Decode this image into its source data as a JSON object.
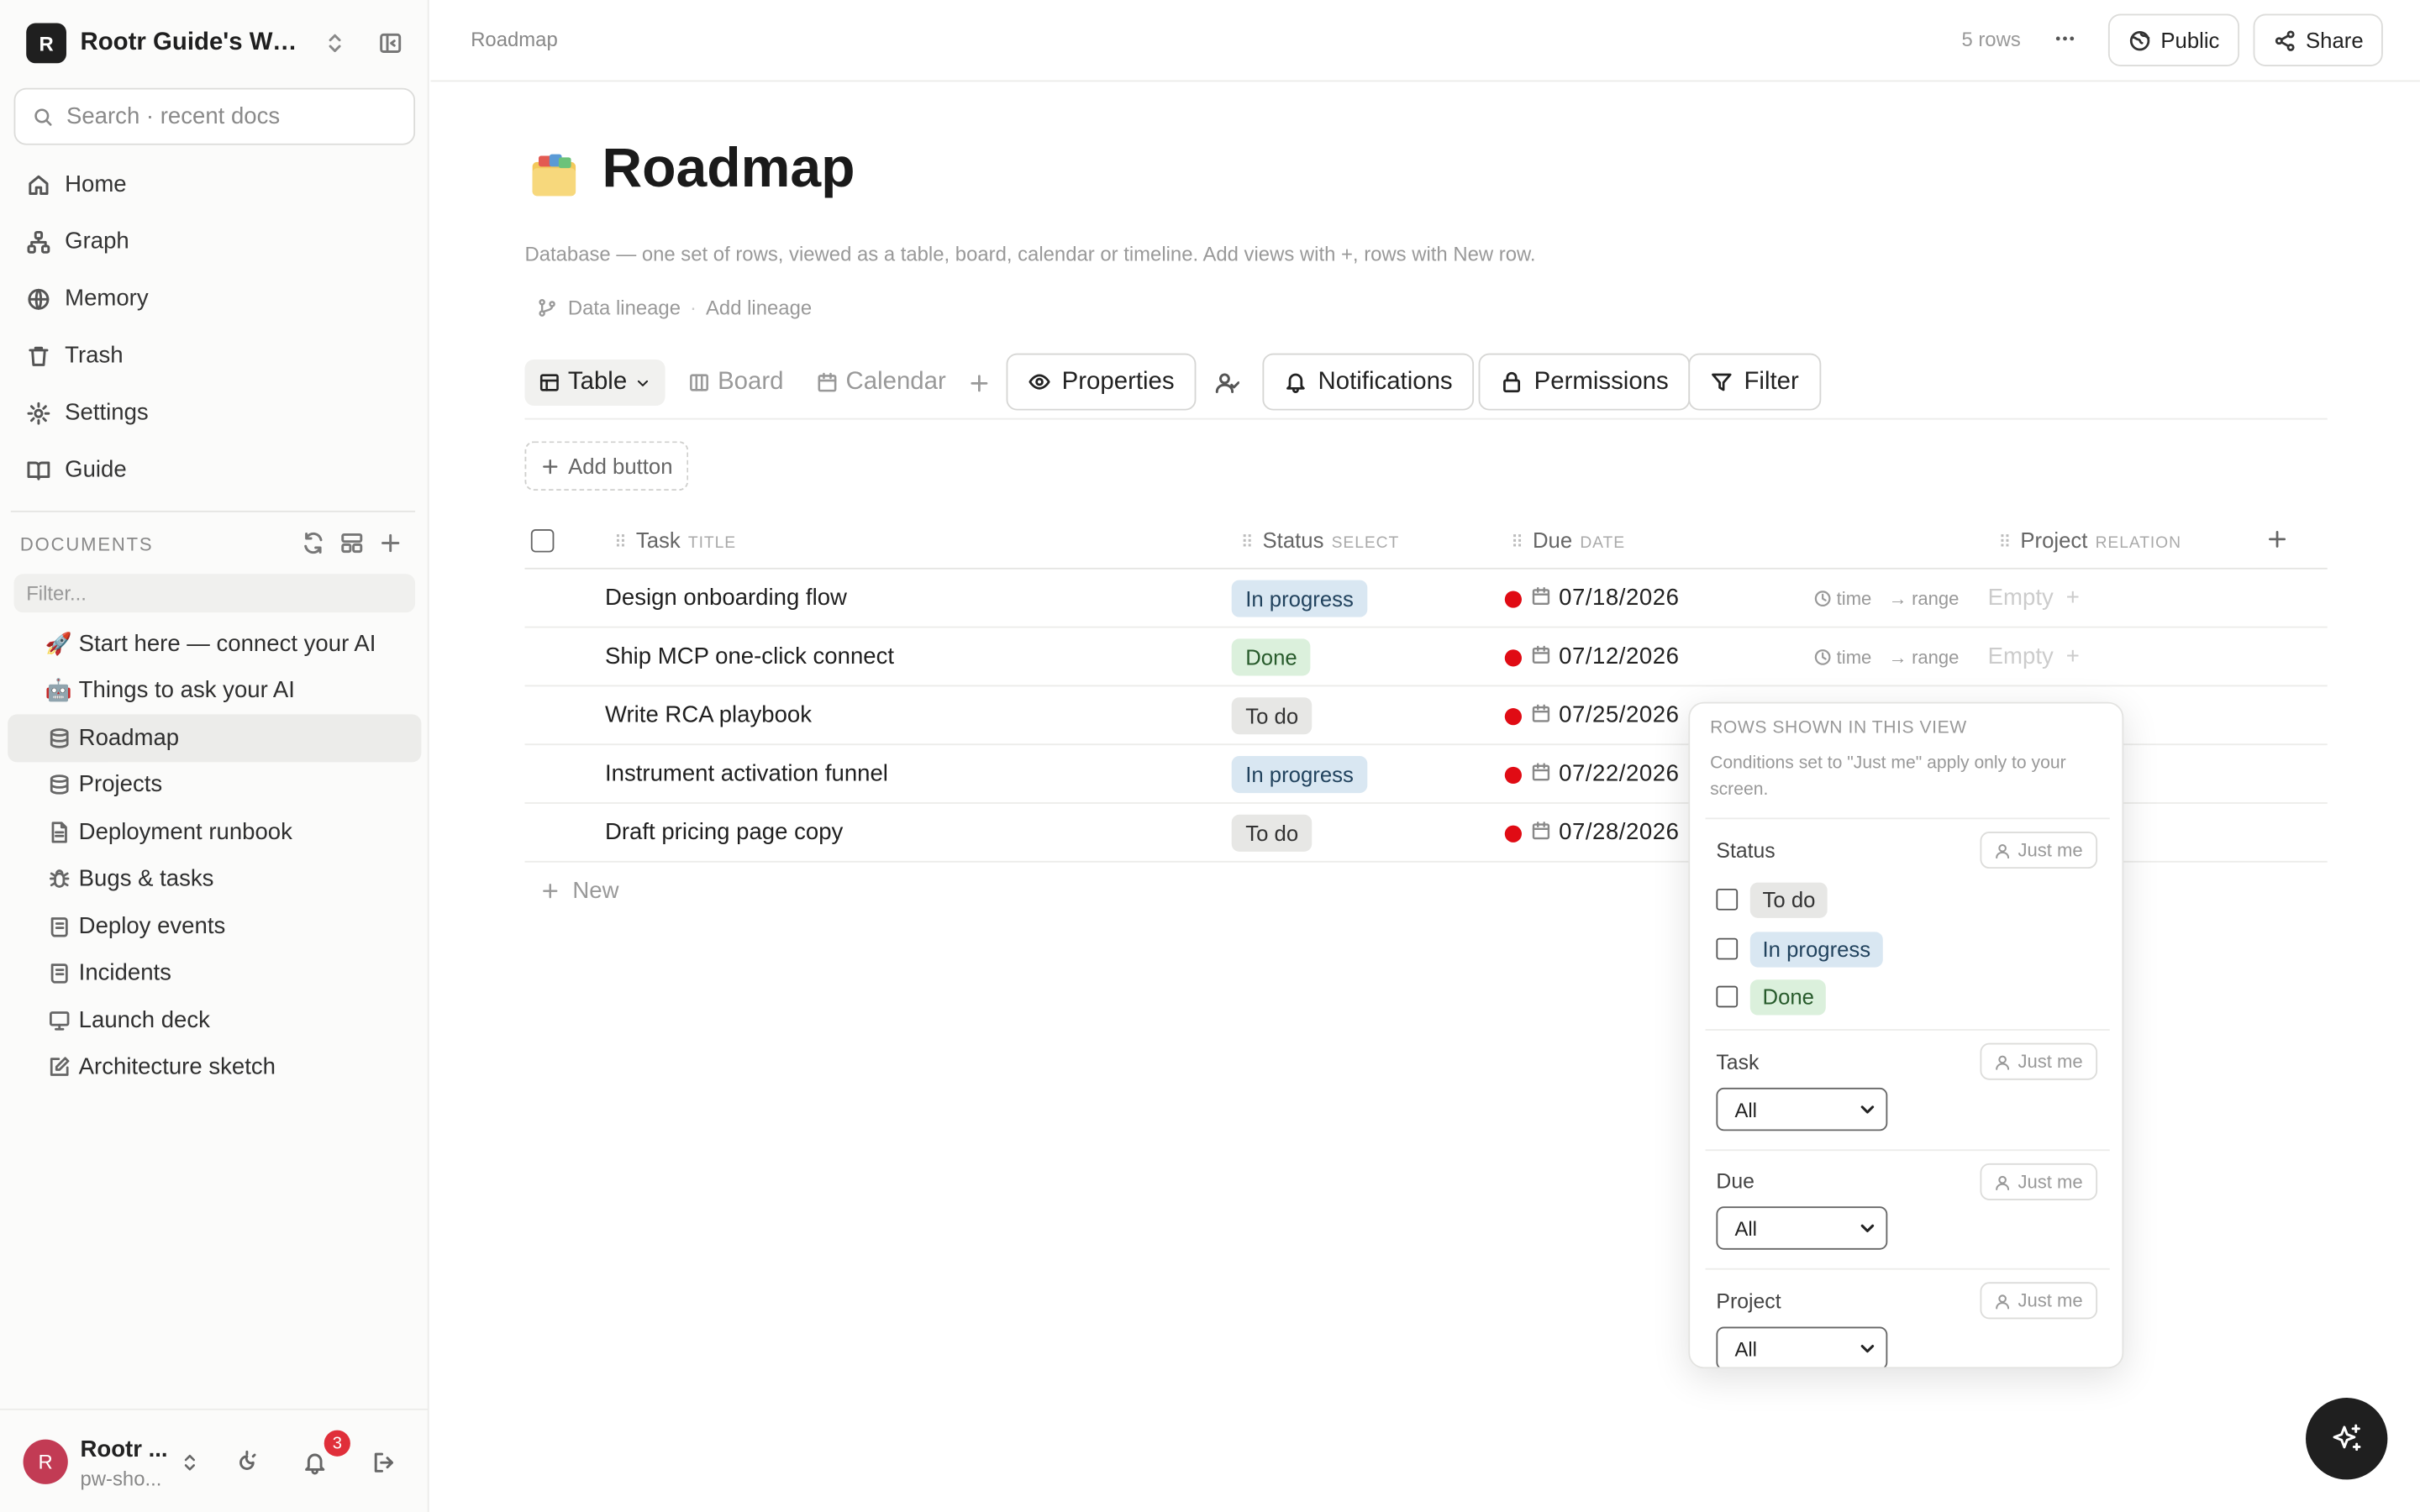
{
  "workspace": {
    "initial": "R",
    "name": "Rootr Guide's Workspace"
  },
  "search": {
    "placeholder": "Search · recent docs"
  },
  "nav": [
    {
      "label": "Home",
      "icon": "home-icon"
    },
    {
      "label": "Graph",
      "icon": "graph-icon"
    },
    {
      "label": "Memory",
      "icon": "memory-icon"
    },
    {
      "label": "Trash",
      "icon": "trash-icon"
    },
    {
      "label": "Settings",
      "icon": "gear-icon"
    },
    {
      "label": "Guide",
      "icon": "book-icon"
    }
  ],
  "documents": {
    "title": "DOCUMENTS",
    "filter_placeholder": "Filter...",
    "items": [
      {
        "label": "Start here — connect your AI",
        "icon": "🚀"
      },
      {
        "label": "Things to ask your AI",
        "icon": "🤖"
      },
      {
        "label": "Roadmap",
        "icon": "database-icon"
      },
      {
        "label": "Projects",
        "icon": "database-icon"
      },
      {
        "label": "Deployment runbook",
        "icon": "document-icon"
      },
      {
        "label": "Bugs & tasks",
        "icon": "bug-icon"
      },
      {
        "label": "Deploy events",
        "icon": "log-icon"
      },
      {
        "label": "Incidents",
        "icon": "log-icon"
      },
      {
        "label": "Launch deck",
        "icon": "presentation-icon"
      },
      {
        "label": "Architecture sketch",
        "icon": "sketch-icon"
      }
    ]
  },
  "user": {
    "initial": "R",
    "name": "Rootr ...",
    "sub": "pw-sho...",
    "notifications": "3"
  },
  "topbar": {
    "breadcrumb": "Roadmap",
    "rows": "5 rows",
    "public_label": "Public",
    "share_label": "Share"
  },
  "page": {
    "emoji": "🗂️",
    "title": "Roadmap",
    "description": "Database — one set of rows, viewed as a table, board, calendar or timeline. Add views with +, rows with New row.",
    "lineage": "Data lineage",
    "add_lineage": "Add lineage"
  },
  "views": {
    "tabs": [
      "Table",
      "Board",
      "Calendar"
    ],
    "properties": "Properties",
    "notifications": "Notifications",
    "permissions": "Permissions",
    "filter": "Filter"
  },
  "add_button": "Add button",
  "table": {
    "columns": [
      {
        "name": "Task",
        "kind": "TITLE"
      },
      {
        "name": "Status",
        "kind": "SELECT"
      },
      {
        "name": "Due",
        "kind": "DATE"
      },
      {
        "name": "Project",
        "kind": "RELATION"
      }
    ],
    "rows": [
      {
        "task": "Design onboarding flow",
        "status": "In progress",
        "due": "07/18/2026",
        "project": "Empty"
      },
      {
        "task": "Ship MCP one-click connect",
        "status": "Done",
        "due": "07/12/2026",
        "project": "Empty"
      },
      {
        "task": "Write RCA playbook",
        "status": "To do",
        "due": "07/25/2026",
        "project": ""
      },
      {
        "task": "Instrument activation funnel",
        "status": "In progress",
        "due": "07/22/2026",
        "project": ""
      },
      {
        "task": "Draft pricing page copy",
        "status": "To do",
        "due": "07/28/2026",
        "project": ""
      }
    ],
    "time_label": "time",
    "range_label": "range",
    "new_label": "New"
  },
  "popover": {
    "title": "ROWS SHOWN IN THIS VIEW",
    "note": "Conditions set to \"Just me\" apply only to your screen.",
    "just_me": "Just me",
    "status_label": "Status",
    "status_options": [
      "To do",
      "In progress",
      "Done"
    ],
    "task_label": "Task",
    "due_label": "Due",
    "project_label": "Project",
    "all_label": "All"
  },
  "colors": {
    "accent_dark": "#1f1f1f",
    "due_dot": "#e00b14",
    "in_progress": "#d9e7f2",
    "done": "#dbf0dc",
    "todo": "#e7e7e5",
    "avatar": "#c23b54"
  }
}
